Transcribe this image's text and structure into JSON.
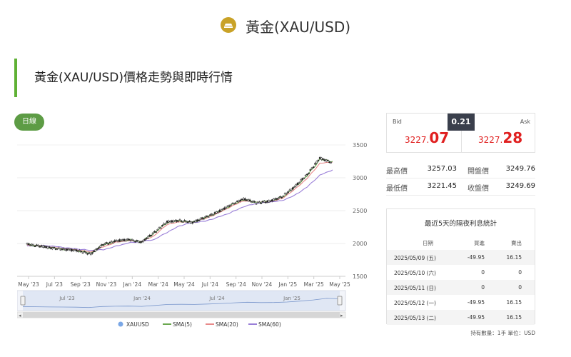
{
  "header": {
    "title": "黃金(XAU/USD)"
  },
  "section": {
    "title": "黃金(XAU/USD)價格走勢與即時行情"
  },
  "timeframe": {
    "label": "日線"
  },
  "quote": {
    "bid_label": "Bid",
    "ask_label": "Ask",
    "spread": "0.21",
    "bid_int": "3227.",
    "bid_dec": "07",
    "ask_int": "3227.",
    "ask_dec": "28"
  },
  "stats": {
    "high_label": "最高價",
    "high": "3257.03",
    "open_label": "開盤價",
    "open": "3249.76",
    "low_label": "最低價",
    "low": "3221.45",
    "close_label": "收盤價",
    "close": "3249.69"
  },
  "interest": {
    "title": "最近5天的隔夜利息統計",
    "headers": {
      "date": "日期",
      "buy": "買進",
      "sell": "賣出"
    },
    "rows": [
      {
        "date": "2025/05/09 (五)",
        "buy": "-49.95",
        "sell": "16.15"
      },
      {
        "date": "2025/05/10 (六)",
        "buy": "0",
        "sell": "0"
      },
      {
        "date": "2025/05/11 (日)",
        "buy": "0",
        "sell": "0"
      },
      {
        "date": "2025/05/12 (一)",
        "buy": "-49.95",
        "sell": "16.15"
      },
      {
        "date": "2025/05/13 (二)",
        "buy": "-49.95",
        "sell": "16.15"
      }
    ]
  },
  "footnote": "持有數量：1手 單位：USD",
  "colors": {
    "accent_green": "#5fb135",
    "button_green": "#5d9c45",
    "price_red": "#e02020",
    "gold": "#c9a227",
    "sma5": "#6aa84f",
    "sma20": "#e88a8a",
    "sma60": "#9a7fd8",
    "navigator": "#c9d6ee"
  },
  "chart_data": {
    "type": "line",
    "x_tick_labels": [
      "May '23",
      "Jul '23",
      "Sep '23",
      "Nov '23",
      "Jan '24",
      "Mar '24",
      "May '24",
      "Jul '24",
      "Sep '24",
      "Nov '24",
      "Jan '25",
      "Mar '25",
      "May '25"
    ],
    "y_tick_labels": [
      "1500",
      "2000",
      "2500",
      "3000",
      "3500"
    ],
    "ylim": [
      1500,
      3500
    ],
    "navigator_labels": [
      "Jul '23",
      "Jan '24",
      "Jul '24",
      "Jan '25"
    ],
    "legend": [
      "XAUUSD",
      "SMA(5)",
      "SMA(20)",
      "SMA(60)"
    ],
    "legend_position": "bottom",
    "x": [
      "2023-05-01",
      "2023-06-01",
      "2023-07-01",
      "2023-08-01",
      "2023-09-01",
      "2023-10-01",
      "2023-11-01",
      "2023-12-01",
      "2024-01-01",
      "2024-02-01",
      "2024-03-01",
      "2024-04-01",
      "2024-05-01",
      "2024-06-01",
      "2024-07-01",
      "2024-08-01",
      "2024-09-01",
      "2024-10-01",
      "2024-11-01",
      "2024-12-01",
      "2025-01-01",
      "2025-02-01",
      "2025-03-01",
      "2025-04-01",
      "2025-05-01"
    ],
    "series": [
      {
        "name": "XAUUSD",
        "values": [
          1990,
          1960,
          1930,
          1910,
          1890,
          1840,
          1990,
          2040,
          2060,
          2020,
          2170,
          2330,
          2350,
          2320,
          2400,
          2480,
          2590,
          2680,
          2620,
          2640,
          2710,
          2860,
          3050,
          3300,
          3227
        ]
      },
      {
        "name": "SMA(5)",
        "values": [
          1985,
          1962,
          1932,
          1912,
          1892,
          1848,
          1980,
          2035,
          2055,
          2025,
          2160,
          2320,
          2345,
          2322,
          2395,
          2475,
          2580,
          2670,
          2625,
          2640,
          2700,
          2850,
          3030,
          3280,
          3250
        ]
      },
      {
        "name": "SMA(20)",
        "values": [
          1975,
          1968,
          1940,
          1920,
          1900,
          1870,
          1950,
          2020,
          2045,
          2030,
          2120,
          2290,
          2330,
          2325,
          2380,
          2460,
          2560,
          2650,
          2630,
          2635,
          2680,
          2820,
          2990,
          3220,
          3240
        ]
      },
      {
        "name": "SMA(60)",
        "values": [
          1960,
          1970,
          1960,
          1935,
          1915,
          1895,
          1905,
          1960,
          2010,
          2030,
          2060,
          2170,
          2270,
          2320,
          2340,
          2400,
          2470,
          2560,
          2610,
          2630,
          2650,
          2730,
          2860,
          3040,
          3120
        ]
      }
    ]
  }
}
